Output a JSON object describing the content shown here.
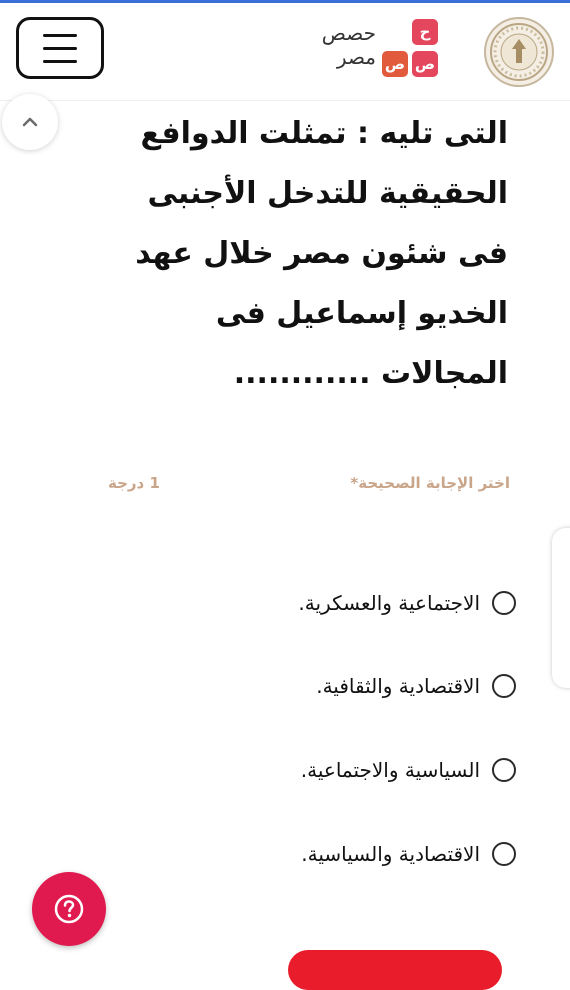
{
  "header": {
    "logo_text_line1": "حصص",
    "logo_text_line2": "مصر",
    "logo_tiles": [
      {
        "glyph": "ح",
        "color": "#e4465e"
      },
      {
        "glyph": "ص",
        "color": "#e25a3c"
      },
      {
        "glyph": "ص",
        "color": "#e4465e"
      }
    ],
    "menu_icon": "hamburger-icon",
    "seal_icon": "ministry-seal-icon"
  },
  "question": {
    "text": "التى تليه : تمثلت الدوافع الحقيقية للتدخل الأجنبى فى شئون مصر خلال عهد الخديو إسماعيل فى المجالات ............"
  },
  "answer_section": {
    "prompt": "اختر الإجابة الصحيحة*",
    "points": "1 درجة"
  },
  "options": [
    {
      "label": "الاجتماعية والعسكرية.",
      "selected": false
    },
    {
      "label": "الاقتصادية والثقافية.",
      "selected": false
    },
    {
      "label": "السياسية والاجتماعية.",
      "selected": false
    },
    {
      "label": "الاقتصادية والسياسية.",
      "selected": false
    }
  ],
  "colors": {
    "fab": "#e0194e",
    "label": "#c9a58a",
    "top_line": "#3b6fd8"
  },
  "icons": {
    "scroll_up": "chevron-up-icon",
    "help": "question-mark-icon"
  }
}
